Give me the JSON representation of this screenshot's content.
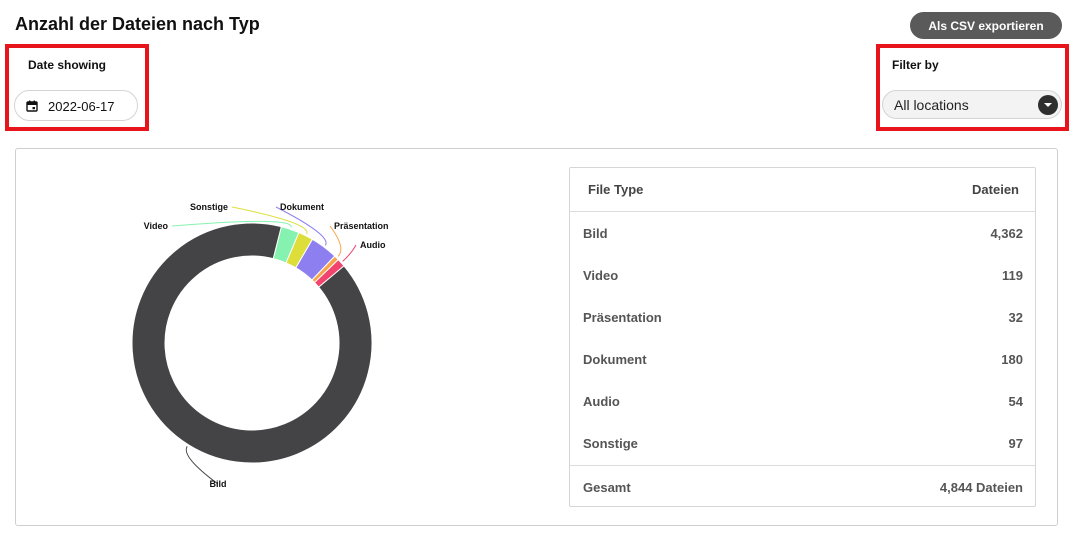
{
  "header": {
    "title": "Anzahl der Dateien nach Typ",
    "export_label": "Als CSV exportieren"
  },
  "date_control": {
    "label": "Date showing",
    "value": "2022-06-17",
    "icon": "calendar-icon"
  },
  "filter_control": {
    "label": "Filter by",
    "value": "All locations",
    "icon": "chevron-down-icon"
  },
  "colors": {
    "highlight_border": "#e8141b",
    "export_button": "#5a5a5a"
  },
  "chart_data": {
    "type": "pie",
    "variant": "donut",
    "categories": [
      "Bild",
      "Video",
      "Sonstige",
      "Dokument",
      "Präsentation",
      "Audio"
    ],
    "values": [
      4362,
      119,
      97,
      180,
      32,
      54
    ],
    "colors": [
      "#444447",
      "#86f2b0",
      "#dede3a",
      "#8e7ff0",
      "#f7a44a",
      "#f2456e"
    ]
  },
  "table": {
    "columns": [
      "File Type",
      "Dateien"
    ],
    "rows": [
      {
        "type": "Bild",
        "count": "4,362"
      },
      {
        "type": "Video",
        "count": "119"
      },
      {
        "type": "Präsentation",
        "count": "32"
      },
      {
        "type": "Dokument",
        "count": "180"
      },
      {
        "type": "Audio",
        "count": "54"
      },
      {
        "type": "Sonstige",
        "count": "97"
      }
    ],
    "total_label": "Gesamt",
    "total_value": "4,844 Dateien"
  }
}
